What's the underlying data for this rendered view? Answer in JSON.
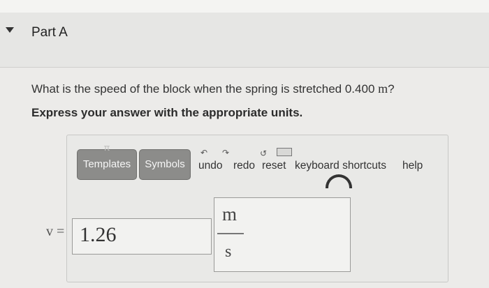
{
  "part": {
    "title": "Part A",
    "caret_icon": "triangle-down-icon"
  },
  "question": {
    "text_before": "What is the speed of the block when the spring is stretched 0.400 ",
    "unit": "m",
    "text_after": "?",
    "instruction": "Express your answer with the appropriate units."
  },
  "toolbar": {
    "templates_label": "Templates",
    "symbols_label": "Symbols",
    "undo_label": "undo",
    "redo_label": "redo",
    "reset_label": "reset",
    "keyboard_shortcuts_label": "keyboard shortcuts",
    "help_label": "help"
  },
  "answer": {
    "variable_symbol": "v =",
    "value": "1.26",
    "unit_numerator": "m",
    "unit_denominator": "s"
  }
}
